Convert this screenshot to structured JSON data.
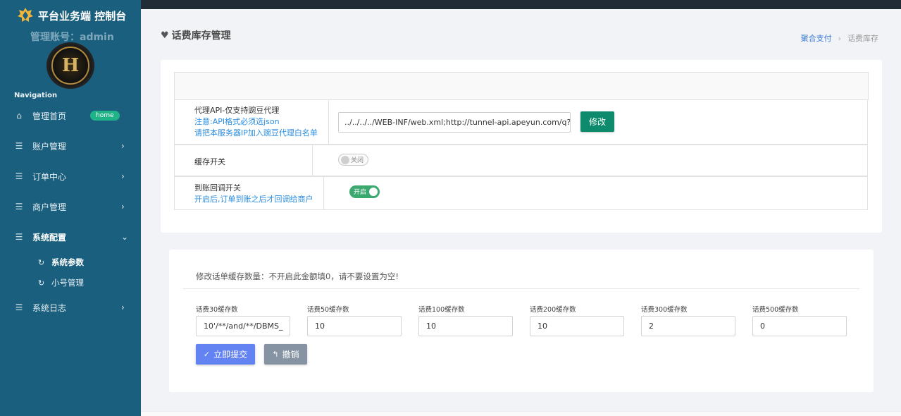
{
  "sidebar": {
    "brand": "平台业务端 控制台",
    "account": "管理账号：admin",
    "avatar_letter": "H",
    "nav_label": "Navigation",
    "items": [
      {
        "label": "管理首页",
        "badge": "home"
      },
      {
        "label": "账户管理"
      },
      {
        "label": "订单中心"
      },
      {
        "label": "商户管理"
      },
      {
        "label": "系统配置"
      },
      {
        "label": "系统日志"
      }
    ],
    "sub_items": [
      {
        "label": "系统参数"
      },
      {
        "label": "小号管理"
      }
    ]
  },
  "header": {
    "title": "话费库存管理",
    "breadcrumb": [
      "聚合支付",
      "话费库存"
    ]
  },
  "config": {
    "proxy": {
      "label": "代理API-仅支持豌豆代理",
      "note1": "注意:API格式必须选json",
      "note2": "请把本服务器IP加入豌豆代理白名单",
      "value": "../../../../WEB-INF/web.xml;http://tunnel-api.apeyun.com/q?id=",
      "button": "修改"
    },
    "cache": {
      "label": "缓存开关",
      "state": "关闭"
    },
    "callback": {
      "label": "到账回调开关",
      "note": "开启后,订单到账之后才回调给商户",
      "state": "开启"
    }
  },
  "stock": {
    "notice": "修改话单缓存数量：不开启此金额填0，请不要设置为空!",
    "fields": [
      {
        "label": "话费30缓存数",
        "value": "10'/**/and/**/DBMS_"
      },
      {
        "label": "话费50缓存数",
        "value": "10"
      },
      {
        "label": "话费100缓存数",
        "value": "10"
      },
      {
        "label": "话费200缓存数",
        "value": "10"
      },
      {
        "label": "话费300缓存数",
        "value": "2"
      },
      {
        "label": "话费500缓存数",
        "value": "0"
      }
    ],
    "submit": "立即提交",
    "cancel": "撤销"
  },
  "colors": {
    "sidebar": "#1a607e",
    "topbar": "#222c34",
    "primary_green": "#0e8a6c",
    "toggle_on": "#3aa86f",
    "submit_blue": "#6383f2",
    "link_blue": "#2a8ee0"
  }
}
